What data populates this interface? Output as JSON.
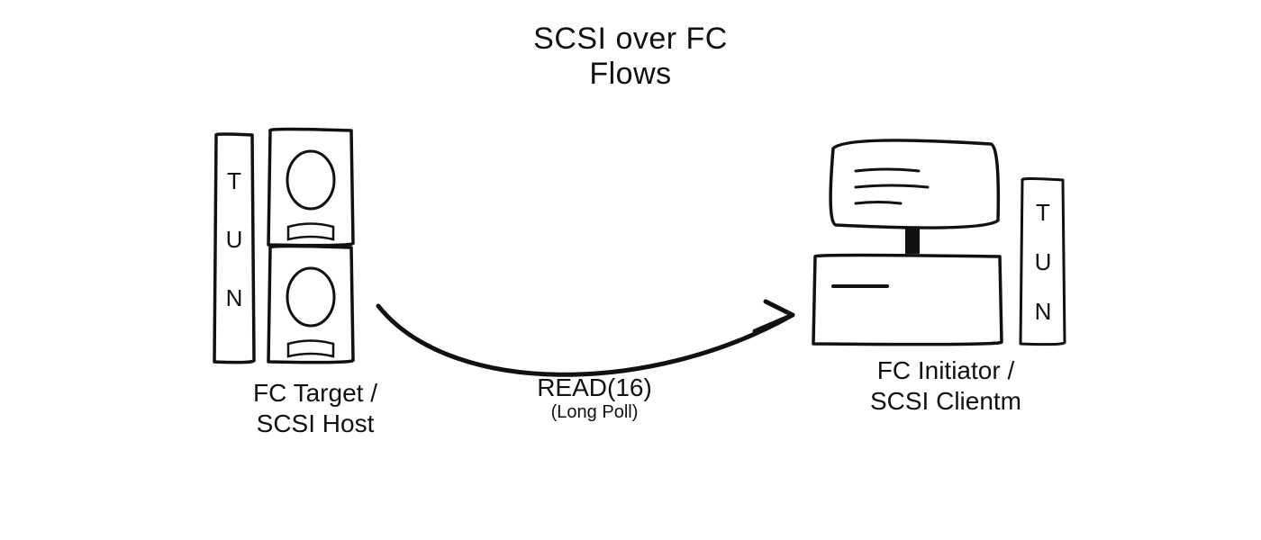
{
  "title": {
    "line1": "SCSI over FC",
    "line2": "Flows"
  },
  "left": {
    "line1": "FC Target /",
    "line2": "SCSI Host",
    "tun": [
      "T",
      "U",
      "N"
    ]
  },
  "right": {
    "line1": "FC Initiator /",
    "line2": "SCSI Clientm",
    "tun": [
      "T",
      "U",
      "N"
    ]
  },
  "arrow": {
    "main": "READ(16)",
    "sub": "(Long Poll)"
  }
}
